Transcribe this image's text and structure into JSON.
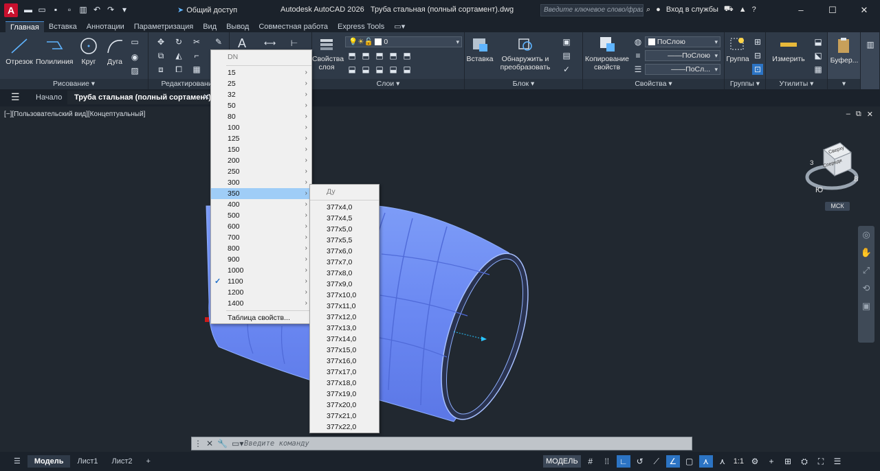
{
  "titlebar": {
    "app_logo": "A",
    "share_label": "Общий доступ",
    "app_title": "Autodesk AutoCAD 2026",
    "doc_name": "Труба стальная (полный сортамент).dwg",
    "search_placeholder": "Введите ключевое слово/фразу",
    "signin_label": "Вход в службы",
    "help_label": "?"
  },
  "ribbon_tabs": [
    "Главная",
    "Вставка",
    "Аннотации",
    "Параметризация",
    "Вид",
    "Вывод",
    "Совместная работа",
    "Express Tools"
  ],
  "ribbon": {
    "draw": {
      "title": "Рисование",
      "line": "Отрезок",
      "polyline": "Полилиния",
      "circle": "Круг",
      "arc": "Дуга"
    },
    "modify": {
      "title": "Редактирование"
    },
    "layers": {
      "title": "Слои",
      "layer_props": "Свойства слоя",
      "current_layer": "0"
    },
    "block": {
      "title": "Блок",
      "insert": "Вставка",
      "detect": "Обнаружить и преобразовать"
    },
    "properties": {
      "title": "Свойства",
      "copy_props": "Копирование свойств",
      "color": "ПоСлою",
      "linetype": "ПоСлою",
      "lineweight": "ПоСл..."
    },
    "groups": {
      "title": "Группы",
      "group": "Группа"
    },
    "utilities": {
      "title": "Утилиты",
      "measure": "Измерить"
    },
    "clipboard": {
      "title": "",
      "paste": "Буфер..."
    }
  },
  "doc_tabs": {
    "start": "Начало",
    "active": "Труба стальная (полный сортамент)*"
  },
  "viewport": {
    "label": "[−][Пользовательский вид][Концептуальный]",
    "ucs_label": "МСК"
  },
  "viewcube": {
    "top": "Сверху",
    "front": "Спереди",
    "south": "Ю",
    "east": "В",
    "west": "З"
  },
  "dn_menu": {
    "header": "DN",
    "items": [
      "15",
      "25",
      "32",
      "50",
      "80",
      "100",
      "125",
      "150",
      "200",
      "250",
      "300",
      "350",
      "400",
      "500",
      "600",
      "700",
      "800",
      "900",
      "1000",
      "1100",
      "1200",
      "1400"
    ],
    "highlighted": "350",
    "checked": "1100",
    "footer": "Таблица свойств..."
  },
  "du_menu": {
    "header": "Ду",
    "items": [
      "377x4,0",
      "377x4,5",
      "377x5,0",
      "377x5,5",
      "377x6,0",
      "377x7,0",
      "377x8,0",
      "377x9,0",
      "377x10,0",
      "377x11,0",
      "377x12,0",
      "377x13,0",
      "377x14,0",
      "377x15,0",
      "377x16,0",
      "377x17,0",
      "377x18,0",
      "377x19,0",
      "377x20,0",
      "377x21,0",
      "377x22,0"
    ]
  },
  "command_line": {
    "placeholder": "Введите команду"
  },
  "status_bar": {
    "layouts": [
      "Модель",
      "Лист1",
      "Лист2"
    ],
    "model_label": "МОДЕЛЬ",
    "scale": "1:1"
  },
  "colors": {
    "accent": "#2c74c4",
    "menu_highlight": "#9fcdf7",
    "pipe": "#6e8df5",
    "background": "#212830"
  }
}
